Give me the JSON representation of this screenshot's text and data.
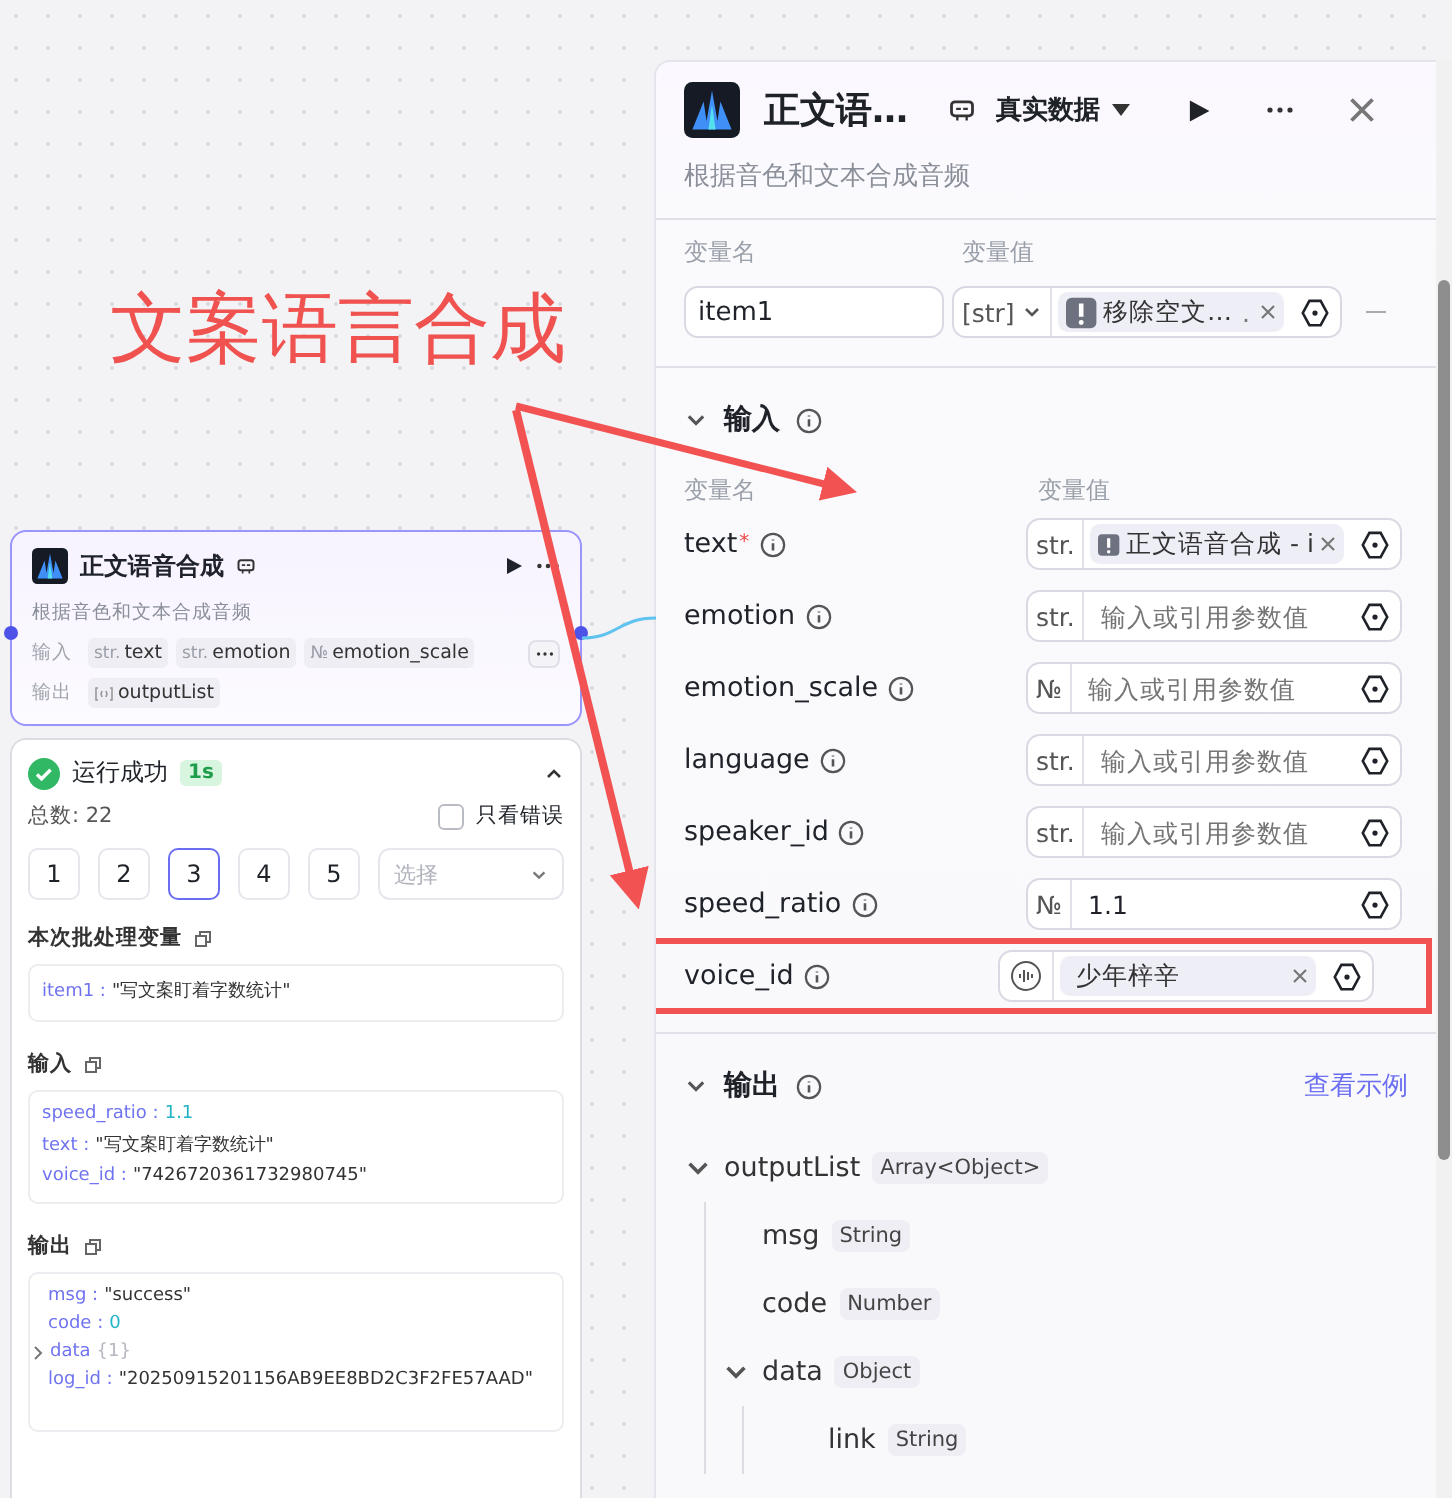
{
  "annotation": {
    "label": "文案语言合成"
  },
  "node": {
    "title": "正文语音合成",
    "description": "根据音色和文本合成音频",
    "inputs_label": "输入",
    "inputs": [
      {
        "type": "str.",
        "name": "text"
      },
      {
        "type": "str.",
        "name": "emotion"
      },
      {
        "type": "№",
        "name": "emotion_scale"
      }
    ],
    "outputs_label": "输出",
    "outputs": [
      {
        "name": "outputList"
      }
    ]
  },
  "run_result": {
    "status": "运行成功",
    "duration": "1s",
    "expanded": true,
    "total": "总数: 22",
    "only_errors": {
      "label": "只看错误",
      "checked": false
    },
    "pages": [
      {
        "label": "1",
        "selected": false
      },
      {
        "label": "2",
        "selected": false
      },
      {
        "label": "3",
        "selected": true
      },
      {
        "label": "4",
        "selected": false
      },
      {
        "label": "5",
        "selected": false
      }
    ],
    "page_select": {
      "placeholder": "选择"
    },
    "sections": [
      {
        "title": "本次批处理变量",
        "lines": [
          {
            "key": "item1 :",
            "kind": "string",
            "value": "\"写文案盯着字数统计\""
          }
        ]
      },
      {
        "title": "输入",
        "lines": [
          {
            "key": "speed_ratio :",
            "kind": "number",
            "value": "1.1"
          },
          {
            "key": "text :",
            "kind": "string",
            "value": "\"写文案盯着字数统计\""
          },
          {
            "key": "voice_id :",
            "kind": "string",
            "value": "\"7426720361732980745\""
          }
        ]
      },
      {
        "title": "输出",
        "lines": [
          {
            "key": "msg :",
            "kind": "string",
            "value": "\"success\""
          },
          {
            "key": "code :",
            "kind": "number",
            "value": "0"
          },
          {
            "key": "data",
            "kind": "object",
            "value": "{1}",
            "expanded": false
          },
          {
            "key": "log_id :",
            "kind": "string",
            "value": "\"20250915201156AB9EE8BD2C3F2FE57AAD\""
          }
        ]
      }
    ]
  },
  "panel": {
    "title": "正文语…",
    "data_mode": "真实数据",
    "description": "根据音色和文本合成音频",
    "batch": {
      "name_header": "变量名",
      "value_header": "变量值",
      "rows": [
        {
          "name": "item1",
          "type": "[str]",
          "value": "移除空文…",
          "suffix": "."
        }
      ]
    },
    "inputs": {
      "title": "输入",
      "expanded": true,
      "required_mark": "*",
      "name_header": "变量名",
      "value_header": "变量值",
      "params": [
        {
          "name": "text",
          "required": true,
          "type": "str.",
          "kind": "reference",
          "value": "正文语音合成 - i",
          "highlighted": false
        },
        {
          "name": "emotion",
          "required": false,
          "type": "str.",
          "kind": "empty",
          "placeholder": "输入或引用参数值",
          "highlighted": false
        },
        {
          "name": "emotion_scale",
          "required": false,
          "type": "№",
          "kind": "empty",
          "placeholder": "输入或引用参数值",
          "highlighted": false
        },
        {
          "name": "language",
          "required": false,
          "type": "str.",
          "kind": "empty",
          "placeholder": "输入或引用参数值",
          "highlighted": false
        },
        {
          "name": "speaker_id",
          "required": false,
          "type": "str.",
          "kind": "empty",
          "placeholder": "输入或引用参数值",
          "highlighted": false
        },
        {
          "name": "speed_ratio",
          "required": false,
          "type": "№",
          "kind": "literal",
          "value": "1.1",
          "highlighted": false
        },
        {
          "name": "voice_id",
          "required": false,
          "kind": "voice",
          "value": "少年梓辛",
          "highlighted": true
        }
      ]
    },
    "outputs": {
      "title": "输出",
      "expanded": true,
      "link": "查看示例",
      "tree": [
        {
          "name": "outputList",
          "type": "Array<Object>",
          "expanded": true,
          "children": [
            {
              "name": "msg",
              "type": "String"
            },
            {
              "name": "code",
              "type": "Number"
            },
            {
              "name": "data",
              "type": "Object",
              "expanded": true,
              "children": [
                {
                  "name": "link",
                  "type": "String"
                }
              ]
            }
          ]
        }
      ]
    }
  }
}
